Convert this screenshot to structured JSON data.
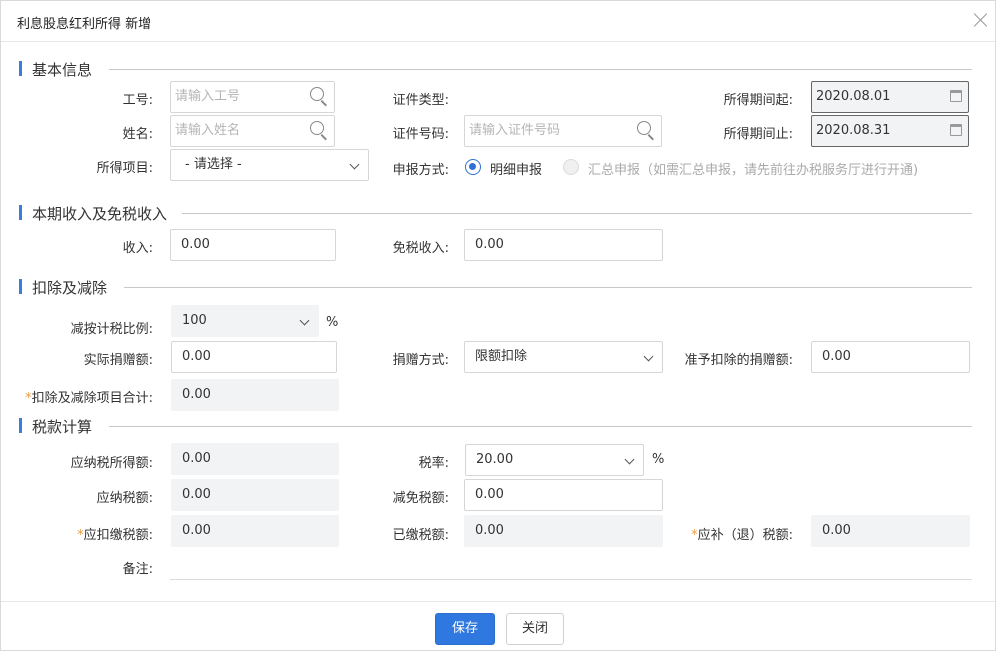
{
  "dialog": {
    "title": "利息股息红利所得 新增"
  },
  "sections": {
    "basic": "基本信息",
    "income": "本期收入及免税收入",
    "deduction": "扣除及减除",
    "tax": "税款计算"
  },
  "basic": {
    "employee_id": {
      "label": "工号:",
      "placeholder": "请输入工号"
    },
    "name": {
      "label": "姓名:",
      "placeholder": "请输入姓名"
    },
    "income_item": {
      "label": "所得项目:",
      "value": "- 请选择 -"
    },
    "id_type": {
      "label": "证件类型:",
      "value": ""
    },
    "id_number": {
      "label": "证件号码:",
      "placeholder": "请输入证件号码"
    },
    "declare_method": {
      "label": "申报方式:",
      "options": [
        {
          "label": "明细申报",
          "selected": true
        },
        {
          "label": "汇总申报（如需汇总申报，请先前往办税服务厅进行开通)",
          "selected": false
        }
      ]
    },
    "period_start": {
      "label": "所得期间起:",
      "value": "2020.08.01"
    },
    "period_end": {
      "label": "所得期间止:",
      "value": "2020.08.31"
    }
  },
  "income": {
    "income": {
      "label": "收入:",
      "value": "0.00"
    },
    "tax_free": {
      "label": "免税收入:",
      "value": "0.00"
    }
  },
  "deduction": {
    "ratio": {
      "label": "减按计税比例:",
      "value": "100",
      "unit": "%"
    },
    "donation": {
      "label": "实际捐赠额:",
      "value": "0.00"
    },
    "donation_method": {
      "label": "捐赠方式:",
      "value": "限额扣除"
    },
    "allowed_donation": {
      "label": "准予扣除的捐赠额:",
      "value": "0.00"
    },
    "total": {
      "label": "扣除及减除项目合计:",
      "value": "0.00",
      "required": "*"
    }
  },
  "tax": {
    "taxable_income": {
      "label": "应纳税所得额:",
      "value": "0.00"
    },
    "rate": {
      "label": "税率:",
      "value": "20.00",
      "unit": "%"
    },
    "tax_payable": {
      "label": "应纳税额:",
      "value": "0.00"
    },
    "tax_reduction": {
      "label": "减免税额:",
      "value": "0.00"
    },
    "withholding": {
      "label": "应扣缴税额:",
      "value": "0.00",
      "required": "*"
    },
    "paid": {
      "label": "已缴税额:",
      "value": "0.00"
    },
    "refund": {
      "label": "应补（退）税额:",
      "value": "0.00",
      "required": "*"
    },
    "notes": {
      "label": "备注:",
      "value": ""
    }
  },
  "footer": {
    "save": "保存",
    "close": "关闭"
  },
  "colors": {
    "accent": "#2f78e0",
    "section_bar": "#3b7ddd",
    "required": "#e99b47"
  }
}
